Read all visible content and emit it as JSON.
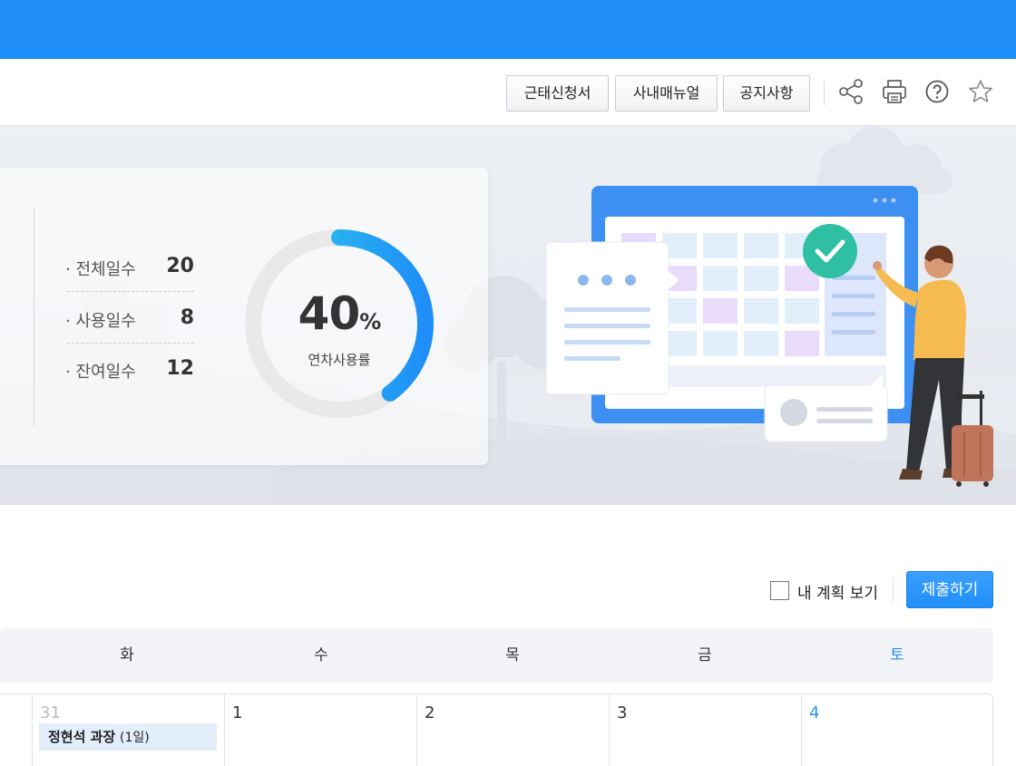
{
  "toolbar": {
    "buttons": [
      "근태신청서",
      "사내매뉴얼",
      "공지사항"
    ],
    "icons": [
      "share-icon",
      "print-icon",
      "help-icon",
      "star-icon"
    ]
  },
  "summary": {
    "stats": [
      {
        "label": "· 전체일수",
        "value": "20"
      },
      {
        "label": "· 사용일수",
        "value": "8"
      },
      {
        "label": "· 잔여일수",
        "value": "12"
      }
    ],
    "usage_percent": 40,
    "usage_number": "40",
    "usage_unit": "%",
    "usage_label": "연차사용률"
  },
  "controls": {
    "checkbox_label": "내 계획 보기",
    "checkbox_checked": false,
    "submit_label": "제출하기"
  },
  "calendar": {
    "weekdays": [
      "화",
      "수",
      "목",
      "금",
      "토"
    ],
    "days": [
      "31",
      "1",
      "2",
      "3",
      "4"
    ],
    "event": {
      "name": "정현석 과장",
      "duration": "(1일)"
    }
  },
  "colors": {
    "accent": "#1f8ef8",
    "saturday": "#2a8ff0",
    "muted_day": "#b8bcc4"
  }
}
